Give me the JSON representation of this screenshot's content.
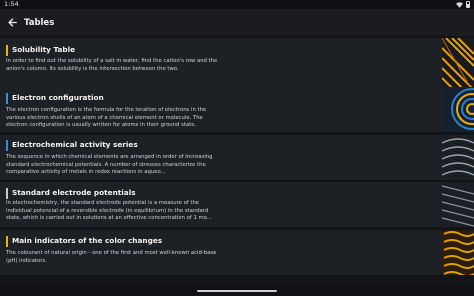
{
  "status": {
    "time": "1:54"
  },
  "header": {
    "title": "Tables"
  },
  "cards": [
    {
      "title": "Solubility Table",
      "accent": "#f0b400",
      "desc": "In order to find out the solubility of a salt in water, find the cation's row and the anion's column. Its solubility is the intersection between the two."
    },
    {
      "title": "Electron configuration",
      "accent": "#2f8fe8",
      "desc": "The electron configuration is the formula for the location of electrons in the various electron shells of an atom of a chemical element or molecule. The electron configuration is usually written for atoms in their ground state."
    },
    {
      "title": "Electrochemical activity series",
      "accent": "#2f8fe8",
      "desc": "The sequence in which chemical elements are arranged in order of increasing standard electrochemical potentials. A number of stresses characterize the comparative activity of metals in redox reactions in aqueo..."
    },
    {
      "title": "Standard electrode potentials",
      "accent": "#c9c9c9",
      "desc": "In electrochemistry, the standard electrode potential is a measure of the individual potencial of a reversible electrode (in equilibrium) in the standard state, which is carried out in solutions at an effective concentration of 1 mo..."
    },
    {
      "title": "Main indicators of the color changes",
      "accent": "#f0b400",
      "desc": "The colourant of natural origin - one of the first and most well-known acid-base (pH) indicators."
    }
  ],
  "icons": {
    "back": "arrow-left-icon",
    "wifi": "wifi-icon",
    "battery": "battery-icon"
  }
}
